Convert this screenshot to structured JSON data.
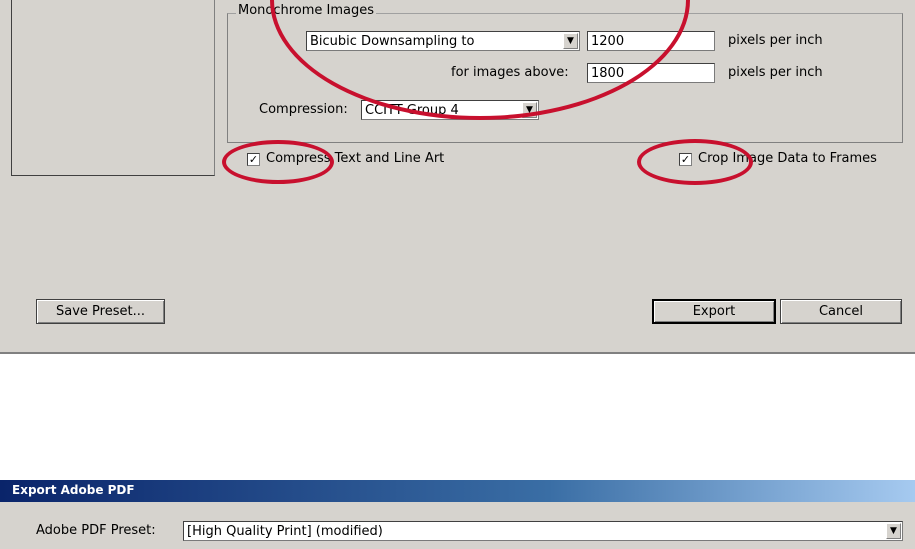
{
  "monochrome": {
    "group_title": "Monochrome Images",
    "downsampling_method": "Bicubic Downsampling to",
    "resolution_value": "1200",
    "resolution_unit": "pixels per inch",
    "above_label": "for images above:",
    "above_value": "1800",
    "above_unit": "pixels per inch",
    "compression_label": "Compression:",
    "compression_value": "CCITT Group 4"
  },
  "options": {
    "compress_text_label": "Compress Text and Line Art",
    "compress_text_checked": true,
    "crop_image_label": "Crop Image Data to Frames",
    "crop_image_checked": true
  },
  "buttons": {
    "save_preset": "Save Preset...",
    "export": "Export",
    "cancel": "Cancel"
  },
  "dialog2": {
    "title": "Export Adobe PDF",
    "preset_label": "Adobe PDF Preset:",
    "preset_value": "[High Quality Print] (modified)"
  },
  "annotation_color": "#c8102e"
}
